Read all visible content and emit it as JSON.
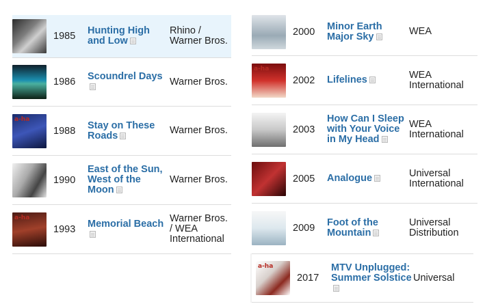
{
  "left_albums": [
    {
      "year": "1985",
      "title": "Hunting High and Low",
      "label": "Rhino / Warner Bros.",
      "cover_icon": "album-cover"
    },
    {
      "year": "1986",
      "title": "Scoundrel Days",
      "label": "Warner Bros.",
      "cover_icon": "album-cover"
    },
    {
      "year": "1988",
      "title": "Stay on These Roads",
      "label": "Warner Bros.",
      "cover_icon": "album-cover"
    },
    {
      "year": "1990",
      "title": "East of the Sun, West of the Moon",
      "label": "Warner Bros.",
      "cover_icon": "album-cover"
    },
    {
      "year": "1993",
      "title": "Memorial Beach",
      "label": "Warner Bros. / WEA International",
      "cover_icon": "album-cover"
    }
  ],
  "right_albums": [
    {
      "year": "2000",
      "title": "Minor Earth Major Sky",
      "label": "WEA",
      "cover_icon": "album-cover"
    },
    {
      "year": "2002",
      "title": "Lifelines",
      "label": "WEA International",
      "cover_icon": "album-cover"
    },
    {
      "year": "2003",
      "title": "How Can I Sleep with Your Voice in My Head",
      "label": "WEA International",
      "cover_icon": "album-cover"
    },
    {
      "year": "2005",
      "title": "Analogue",
      "label": "Universal International",
      "cover_icon": "album-cover"
    },
    {
      "year": "2009",
      "title": "Foot of the Mountain",
      "label": "Universal Distribution",
      "cover_icon": "album-cover"
    }
  ],
  "last_album": {
    "year": "2017",
    "title": "MTV Unplugged: Summer Solstice",
    "label": "Universal",
    "cover_icon": "album-cover"
  },
  "cover_texts": {
    "c3": "a-ha",
    "c5": "a-ha",
    "c7": "a-ha",
    "c11": "a-ha"
  },
  "colors": {
    "link": "#2b6ea6",
    "highlight": "#e8f4fc"
  }
}
